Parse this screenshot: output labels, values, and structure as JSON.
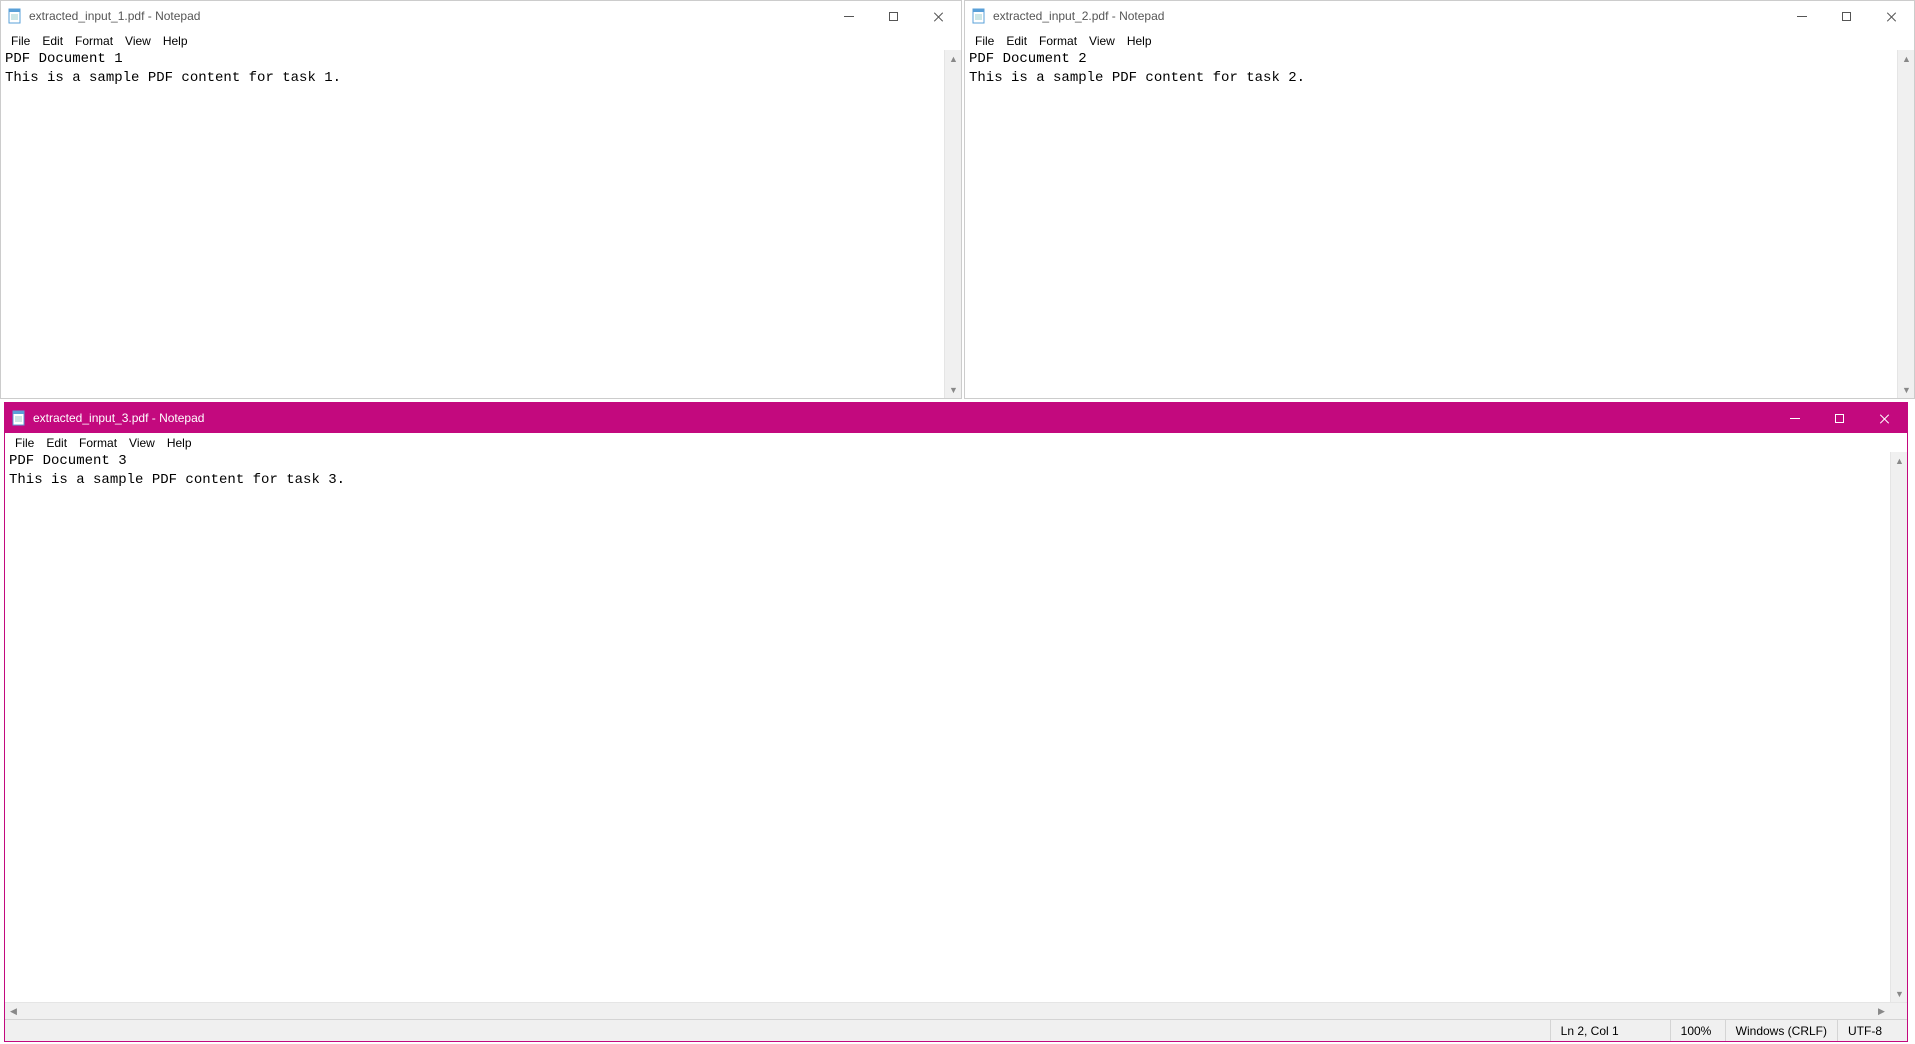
{
  "windows": {
    "w1": {
      "title": "extracted_input_1.pdf - Notepad",
      "menus": {
        "file": "File",
        "edit": "Edit",
        "format": "Format",
        "view": "View",
        "help": "Help"
      },
      "line1": "PDF Document 1",
      "line2": "This is a sample PDF content for task 1."
    },
    "w2": {
      "title": "extracted_input_2.pdf - Notepad",
      "menus": {
        "file": "File",
        "edit": "Edit",
        "format": "Format",
        "view": "View",
        "help": "Help"
      },
      "line1": "PDF Document 2",
      "line2": "This is a sample PDF content for task 2."
    },
    "w3": {
      "title": "extracted_input_3.pdf - Notepad",
      "menus": {
        "file": "File",
        "edit": "Edit",
        "format": "Format",
        "view": "View",
        "help": "Help"
      },
      "line1": "PDF Document 3",
      "line2": "This is a sample PDF content for task 3.",
      "status": {
        "position": "Ln 2, Col 1",
        "zoom": "100%",
        "lineending": "Windows (CRLF)",
        "encoding": "UTF-8"
      }
    }
  }
}
